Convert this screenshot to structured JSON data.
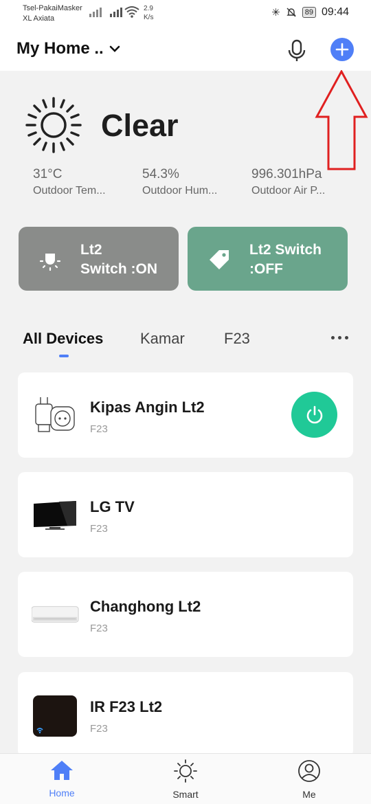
{
  "status_bar": {
    "carrier_line1": "Tsel-PakaiMasker",
    "carrier_line2": "XL Axiata",
    "net_speed_value": "2.9",
    "net_speed_unit": "K/s",
    "battery": "89",
    "time": "09:44"
  },
  "header": {
    "home_name": "My Home ..",
    "mic_icon": "microphone-icon",
    "add_icon": "plus-icon"
  },
  "weather": {
    "condition": "Clear",
    "icon": "sun-icon",
    "stats": [
      {
        "value": "31°C",
        "label": "Outdoor Tem..."
      },
      {
        "value": "54.3%",
        "label": "Outdoor Hum..."
      },
      {
        "value": "996.301hPa",
        "label": "Outdoor Air P..."
      }
    ]
  },
  "scenes": [
    {
      "line1": "Lt2",
      "line2": "Switch :ON",
      "icon": "lightbulb-icon",
      "color": "#8a8c8a"
    },
    {
      "line1": "Lt2 Switch",
      "line2": ":OFF",
      "icon": "tag-icon",
      "color": "#6aa58c"
    }
  ],
  "tabs": {
    "items": [
      "All Devices",
      "Kamar",
      "F23"
    ],
    "active": "All Devices"
  },
  "devices": [
    {
      "name": "Kipas Angin Lt2",
      "room": "F23",
      "thumb": "smart-plug",
      "power": true
    },
    {
      "name": "LG TV",
      "room": "F23",
      "thumb": "tv"
    },
    {
      "name": "Changhong Lt2",
      "room": "F23",
      "thumb": "air-conditioner"
    },
    {
      "name": "IR F23 Lt2",
      "room": "F23",
      "thumb": "ir-blaster"
    }
  ],
  "bottom_nav": [
    {
      "label": "Home",
      "icon": "home-icon",
      "active": true
    },
    {
      "label": "Smart",
      "icon": "sun-icon"
    },
    {
      "label": "Me",
      "icon": "user-icon"
    }
  ],
  "colors": {
    "accent": "#4f7ff7",
    "power_green": "#20c997",
    "annotation_red": "#e02020"
  }
}
